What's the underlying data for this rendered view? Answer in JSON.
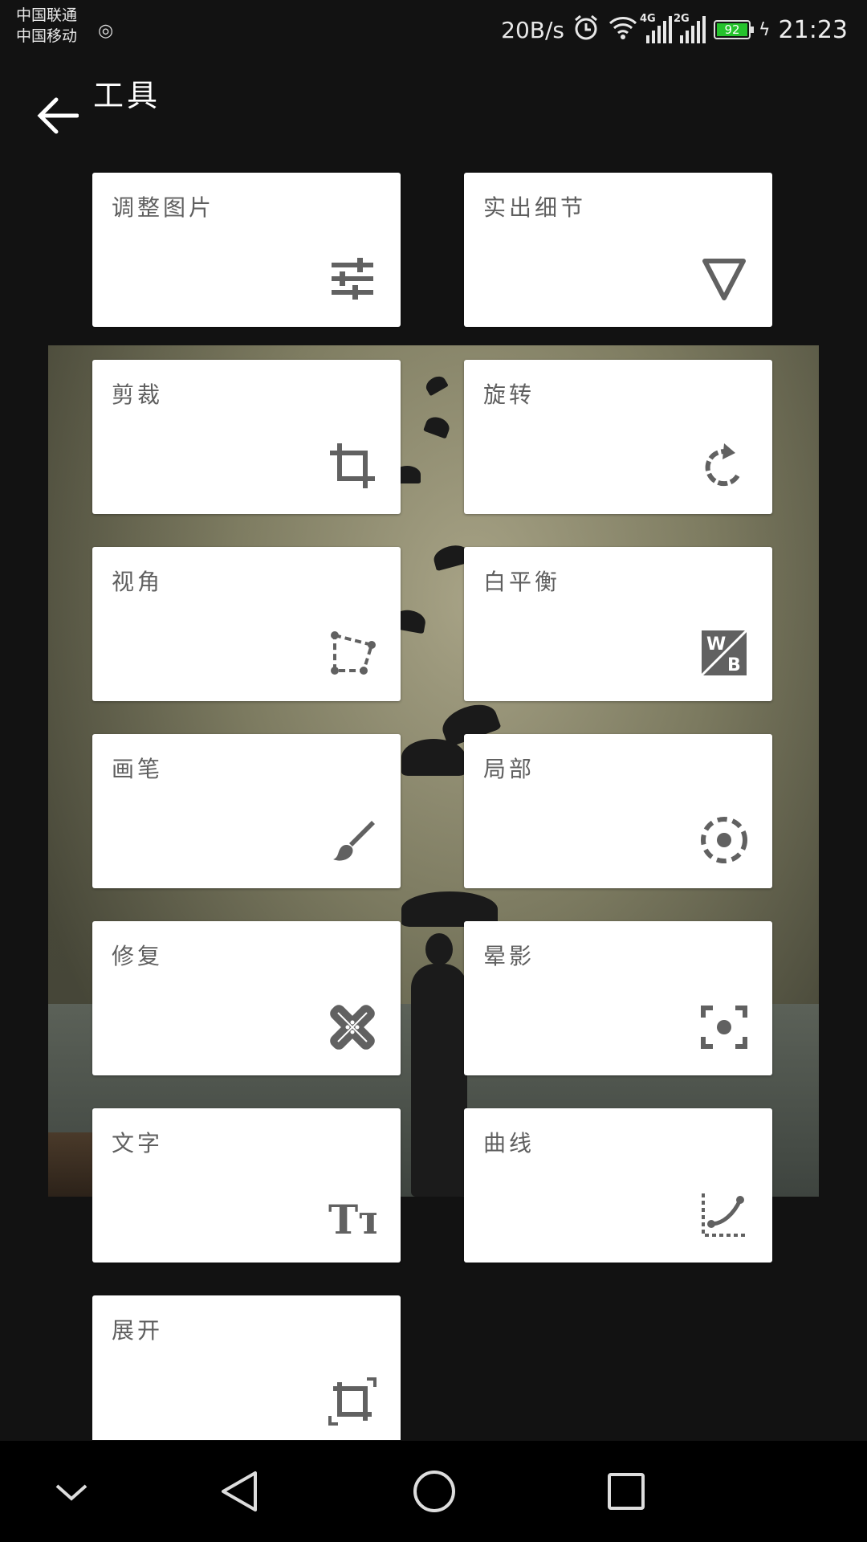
{
  "status_bar": {
    "carrier_1": "中国联通",
    "carrier_2": "中国移动",
    "net_speed": "20B/s",
    "net_4g": "4G",
    "net_2g": "2G",
    "battery": "92",
    "time": "21:23"
  },
  "header": {
    "title": "工具"
  },
  "tools": [
    {
      "label": "调整图片",
      "icon": "tune-icon"
    },
    {
      "label": "实出细节",
      "icon": "triangle-down-icon"
    },
    {
      "label": "剪裁",
      "icon": "crop-icon"
    },
    {
      "label": "旋转",
      "icon": "rotate-icon"
    },
    {
      "label": "视角",
      "icon": "perspective-icon"
    },
    {
      "label": "白平衡",
      "icon": "wb-icon"
    },
    {
      "label": "画笔",
      "icon": "brush-icon"
    },
    {
      "label": "局部",
      "icon": "selective-icon"
    },
    {
      "label": "修复",
      "icon": "healing-icon"
    },
    {
      "label": "晕影",
      "icon": "vignette-icon"
    },
    {
      "label": "文字",
      "icon": "text-icon"
    },
    {
      "label": "曲线",
      "icon": "curves-icon"
    },
    {
      "label": "展开",
      "icon": "expand-icon"
    }
  ],
  "wb_icon_letters": {
    "top": "W",
    "bottom": "B"
  },
  "text_icon_letters": "Tт",
  "colors": {
    "background": "#121212",
    "card": "#ffffff",
    "icon": "#616161",
    "label": "#5f5f5f",
    "battery": "#25c22c"
  }
}
